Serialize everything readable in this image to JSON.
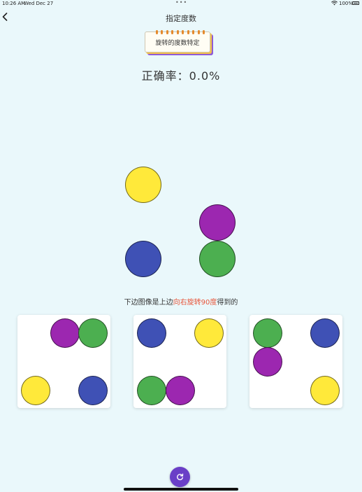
{
  "status_bar": {
    "time": "10:26 AM",
    "date": "Wed Dec 27",
    "dots": "•••",
    "battery": "100%"
  },
  "nav": {
    "title": "指定度数",
    "back_icon": "chevron-left-icon"
  },
  "mode_card": {
    "label": "旋转的度数特定"
  },
  "accuracy": {
    "text": "正确率：0.0%"
  },
  "colors": {
    "yellow": "#ffe93a",
    "purple": "#9c27b0",
    "blue": "#3f51b5",
    "green": "#4caf50",
    "highlight": "#e8553a",
    "button": "#6a3fc7",
    "background": "#eaf8fb"
  },
  "target": {
    "balls": [
      "yellow",
      "purple",
      "blue",
      "green"
    ]
  },
  "question": {
    "prefix": "下边图像是上边",
    "highlight": "向右旋转90度",
    "suffix": "得到的"
  },
  "options": [
    {
      "balls": [
        "purple",
        "green",
        "yellow",
        "blue"
      ]
    },
    {
      "balls": [
        "blue",
        "yellow",
        "green",
        "purple"
      ]
    },
    {
      "balls": [
        "green",
        "blue",
        "purple",
        "yellow"
      ]
    }
  ],
  "refresh_icon": "refresh-icon"
}
